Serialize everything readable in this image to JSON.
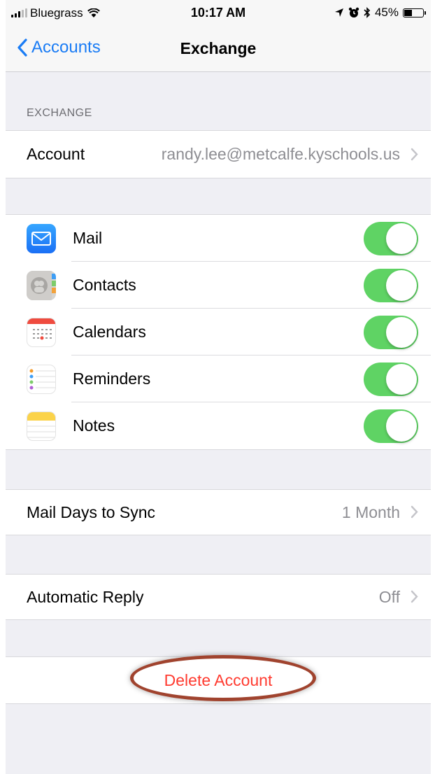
{
  "status_bar": {
    "carrier": "Bluegrass",
    "time": "10:17 AM",
    "battery_percent": "45%",
    "battery_level": 0.45,
    "icons": [
      "signal-icon",
      "wifi-icon",
      "location-icon",
      "alarm-icon",
      "bluetooth-icon",
      "battery-icon"
    ]
  },
  "nav": {
    "back_label": "Accounts",
    "title": "Exchange"
  },
  "exchange_section": {
    "header": "EXCHANGE",
    "account_label": "Account",
    "account_value": "randy.lee@metcalfe.kyschools.us"
  },
  "services": [
    {
      "label": "Mail",
      "icon": "mail-icon",
      "enabled": true
    },
    {
      "label": "Contacts",
      "icon": "contacts-icon",
      "enabled": true
    },
    {
      "label": "Calendars",
      "icon": "calendar-icon",
      "enabled": true
    },
    {
      "label": "Reminders",
      "icon": "reminders-icon",
      "enabled": true
    },
    {
      "label": "Notes",
      "icon": "notes-icon",
      "enabled": true
    }
  ],
  "sync": {
    "label": "Mail Days to Sync",
    "value": "1 Month"
  },
  "reply": {
    "label": "Automatic Reply",
    "value": "Off"
  },
  "delete_label": "Delete Account",
  "colors": {
    "accent": "#1a7cf5",
    "toggle_on": "#5fd364",
    "destructive": "#ff3b30",
    "annotation": "#a0432e"
  }
}
